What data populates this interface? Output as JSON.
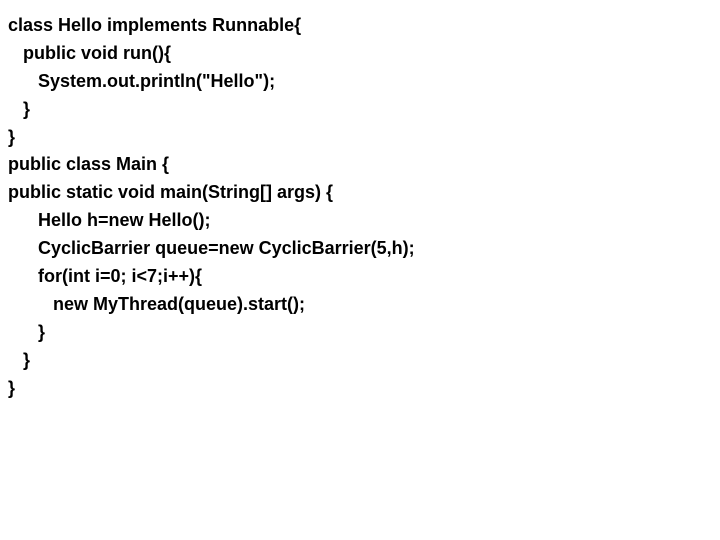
{
  "code": {
    "lines": [
      "class Hello implements Runnable{",
      "   public void run(){",
      "      System.out.println(\"Hello\");",
      "   }",
      "}",
      "public class Main {",
      "public static void main(String[] args) {",
      "      Hello h=new Hello();",
      "      CyclicBarrier queue=new CyclicBarrier(5,h);",
      "      for(int i=0; i<7;i++){",
      "         new MyThread(queue).start();",
      "      }",
      "   }",
      "}"
    ]
  }
}
